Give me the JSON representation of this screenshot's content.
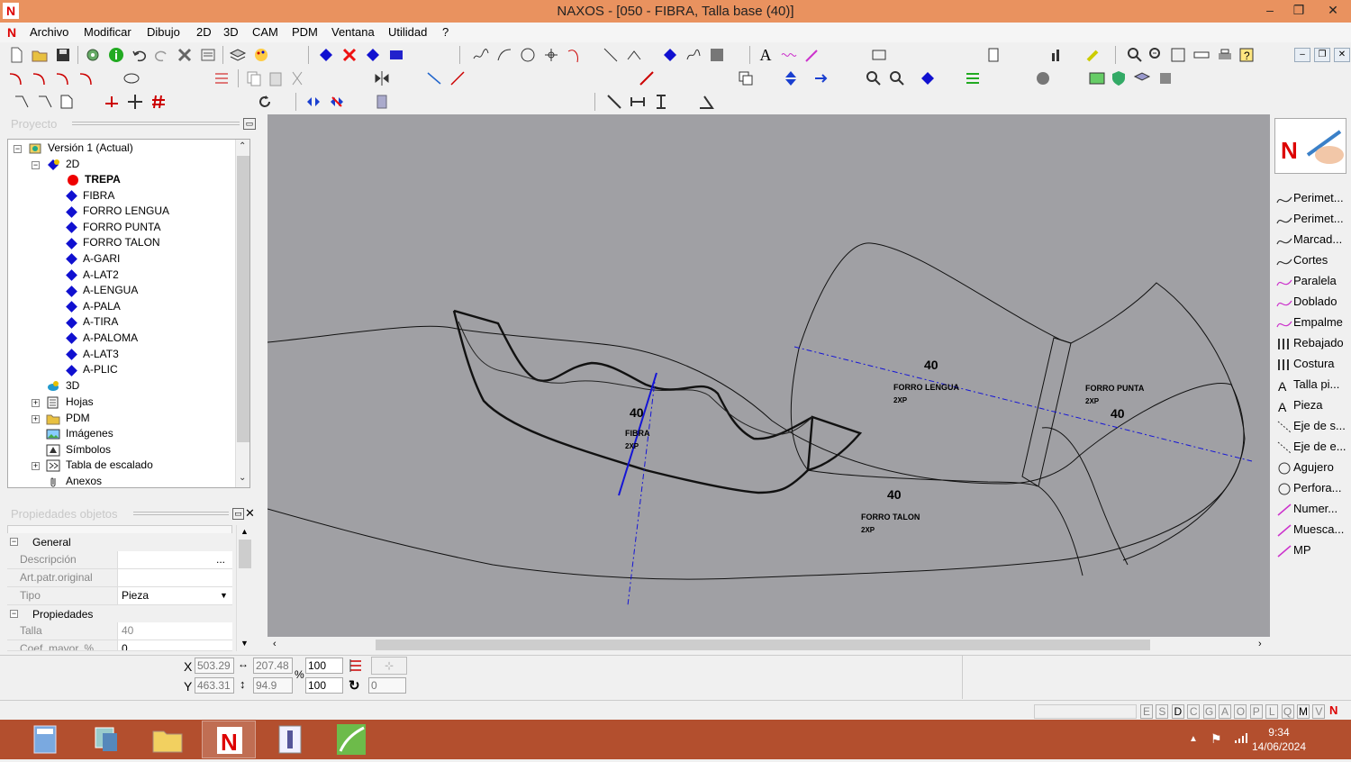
{
  "app": {
    "title": "NAXOS - [050 - FIBRA, Talla base (40)]",
    "logo_letter": "N",
    "window_buttons": [
      "‒",
      "❐",
      "✕"
    ]
  },
  "menu": {
    "items": [
      "Archivo",
      "Modificar",
      "Dibujo",
      "2D",
      "3D",
      "CAM",
      "PDM",
      "Ventana",
      "Utilidad",
      "?"
    ]
  },
  "project_panel": {
    "title": "Proyecto",
    "tree": {
      "root": "Versión 1 (Actual)",
      "node_2d": "2D",
      "pieces": [
        {
          "label": "TREPA",
          "color": "#e00000",
          "bold": true
        },
        {
          "label": "FIBRA"
        },
        {
          "label": "FORRO LENGUA"
        },
        {
          "label": "FORRO PUNTA"
        },
        {
          "label": "FORRO TALON"
        },
        {
          "label": "A-GARI"
        },
        {
          "label": "A-LAT2"
        },
        {
          "label": "A-LENGUA"
        },
        {
          "label": "A-PALA"
        },
        {
          "label": "A-TIRA"
        },
        {
          "label": "A-PALOMA"
        },
        {
          "label": "A-LAT3"
        },
        {
          "label": "A-PLIC"
        }
      ],
      "node_3d": "3D",
      "folders": [
        "Hojas",
        "PDM",
        "Imágenes",
        "Símbolos",
        "Tabla de escalado",
        "Anexos"
      ]
    }
  },
  "props_panel": {
    "title": "Propiedades objetos",
    "group_general": "General",
    "descripcion_key": "Descripción",
    "descripcion_btn": "...",
    "art_key": "Art.patr.original",
    "tipo_key": "Tipo",
    "tipo_value": "Pieza",
    "group_propiedades": "Propiedades",
    "talla_key": "Talla",
    "talla_value": "40",
    "coef_key": "Coef. mayor. %",
    "coef_value": "0"
  },
  "canvas": {
    "pieces": [
      {
        "size": "40",
        "name": "FIBRA",
        "qty": "2XP"
      },
      {
        "size": "40",
        "name": "FORRO LENGUA",
        "qty": "2XP"
      },
      {
        "size": "40",
        "name": "FORRO PUNTA",
        "qty": "2XP"
      },
      {
        "size": "40",
        "name": "FORRO TALON",
        "qty": "2XP"
      }
    ]
  },
  "right_panel": {
    "items": [
      "Perimet...",
      "Perimet...",
      "Marcad...",
      "Cortes",
      "Paralela",
      "Doblado",
      "Empalme",
      "Rebajado",
      "Costura",
      "Talla pi...",
      "Pieza",
      "Eje de s...",
      "Eje de e...",
      "Agujero",
      "Perfora...",
      "Numer...",
      "Muesca...",
      "MP"
    ]
  },
  "coords": {
    "x_label": "X",
    "y_label": "Y",
    "x": "503.29",
    "y": "463.31",
    "width": "207.48",
    "height": "94.9",
    "percent_symbol": "%",
    "scale_x": "100",
    "scale_y": "100",
    "rotation": "0"
  },
  "status": {
    "letters": [
      "E",
      "S",
      "D",
      "C",
      "G",
      "A",
      "O",
      "P",
      "L",
      "Q",
      "M",
      "V"
    ]
  },
  "taskbar": {
    "time": "9:34",
    "date": "14/06/2024"
  },
  "colors": {
    "titlebar": "#e9925f",
    "taskbar": "#b34f2e",
    "canvas": "#a0a0a4",
    "tree_diamond": "#1010d0",
    "axis_line": "#1515d6"
  }
}
